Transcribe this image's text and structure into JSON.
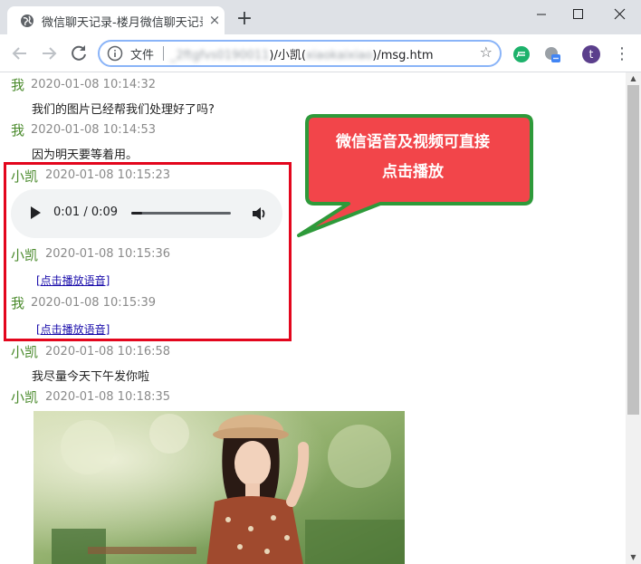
{
  "browser": {
    "tab_title": "微信聊天记录-楼月微信聊天记录",
    "tab_close": "×",
    "new_tab": "+",
    "address": {
      "scheme_label": "文件",
      "url_prefix_blurred": "_2ftgfvs0190011",
      "url_mid": ")/小凯(",
      "url_mid_blurred": "xiaokaixiao",
      "url_suffix": ")/msg.htm"
    },
    "profile_initial": "t",
    "colors": {
      "omnibox_border": "#8ab4f8",
      "tabstrip": "#dee1e6"
    }
  },
  "messages": [
    {
      "sender": "我",
      "time": "2020-01-08 10:14:32",
      "text": "我们的图片已经帮我们处理好了吗?"
    },
    {
      "sender": "我",
      "time": "2020-01-08 10:14:53",
      "text": "因为明天要等着用。"
    },
    {
      "sender": "小凯",
      "time": "2020-01-08 10:15:23",
      "audio": {
        "current": "0:01",
        "separator": "/",
        "duration": "0:09",
        "progress": 0.11
      }
    },
    {
      "sender": "小凯",
      "time": "2020-01-08 10:15:36",
      "link": "[点击播放语音]"
    },
    {
      "sender": "我",
      "time": "2020-01-08 10:15:39",
      "link": "[点击播放语音]"
    },
    {
      "sender": "小凯",
      "time": "2020-01-08 10:16:58",
      "text": "我尽量今天下午发你啦"
    },
    {
      "sender": "小凯",
      "time": "2020-01-08 10:18:35",
      "image": "photo of a woman in a beret"
    }
  ],
  "callout": {
    "line1": "微信语音及视频可直接",
    "line2": "点击播放",
    "colors": {
      "fill": "#f2454a",
      "border": "#2e9a3a"
    }
  },
  "highlight_color": "#e3061d",
  "sender_color": "#4a8a2c"
}
